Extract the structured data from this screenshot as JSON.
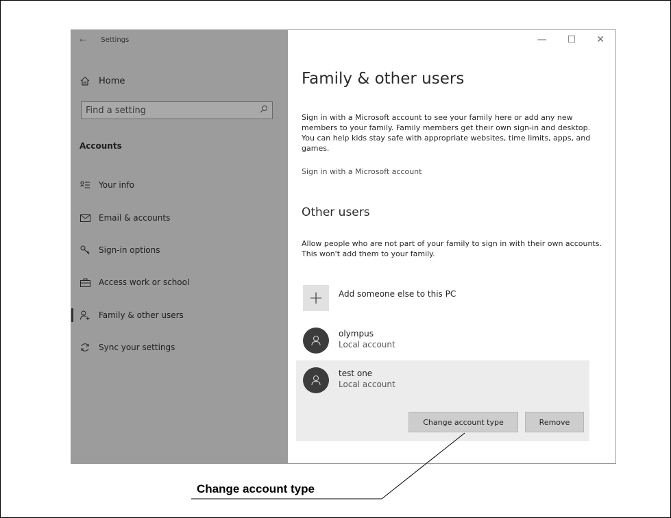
{
  "window": {
    "title": "Settings",
    "controls": {
      "minimize": "—",
      "maximize": "☐",
      "close": "✕"
    }
  },
  "sidebar": {
    "home_label": "Home",
    "search_placeholder": "Find a setting",
    "section_title": "Accounts",
    "items": [
      {
        "label": "Your info",
        "icon": "your-info-icon"
      },
      {
        "label": "Email & accounts",
        "icon": "mail-icon"
      },
      {
        "label": "Sign-in options",
        "icon": "key-icon"
      },
      {
        "label": "Access work or school",
        "icon": "briefcase-icon"
      },
      {
        "label": "Family & other users",
        "icon": "person-add-icon",
        "selected": true
      },
      {
        "label": "Sync your settings",
        "icon": "sync-icon"
      }
    ]
  },
  "main": {
    "title": "Family & other users",
    "family_description": "Sign in with a Microsoft account to see your family here or add any new members to your family. Family members get their own sign-in and desktop. You can help kids stay safe with appropriate websites, time limits, apps, and games.",
    "microsoft_link": "Sign in with a Microsoft account",
    "other_users_title": "Other users",
    "other_users_description": "Allow people who are not part of your family to sign in with their own accounts. This won't add them to your family.",
    "add_user_label": "Add someone else to this PC",
    "users": [
      {
        "name": "olympus",
        "type": "Local account"
      },
      {
        "name": "test one",
        "type": "Local account"
      }
    ],
    "change_account_type_button": "Change account type",
    "remove_button": "Remove"
  },
  "callout": {
    "label": "Change account type"
  }
}
